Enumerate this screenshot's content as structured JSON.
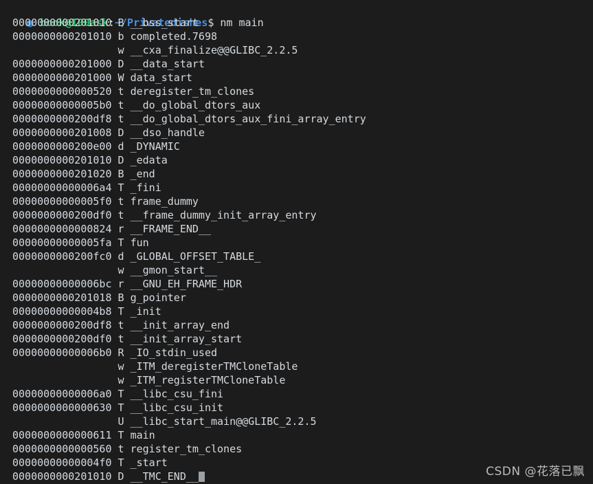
{
  "terminal": {
    "background_color": "#1c1c1c",
    "foreground_color": "#d6dbe0",
    "prompt": {
      "bullet": "●",
      "bullet_color": "#2878c0",
      "user_host": "book@100ask",
      "user_host_color": "#27c46b",
      "separator": ":",
      "path": "~/Privatedishes",
      "path_color": "#4a8fe0",
      "sigil_and_command": "$ nm main",
      "command": "nm main"
    },
    "output_lines": [
      "0000000000201010 B __bss_start",
      "0000000000201010 b completed.7698",
      "                 w __cxa_finalize@@GLIBC_2.2.5",
      "0000000000201000 D __data_start",
      "0000000000201000 W data_start",
      "0000000000000520 t deregister_tm_clones",
      "00000000000005b0 t __do_global_dtors_aux",
      "0000000000200df8 t __do_global_dtors_aux_fini_array_entry",
      "0000000000201008 D __dso_handle",
      "0000000000200e00 d _DYNAMIC",
      "0000000000201010 D _edata",
      "0000000000201020 B _end",
      "00000000000006a4 T _fini",
      "00000000000005f0 t frame_dummy",
      "0000000000200df0 t __frame_dummy_init_array_entry",
      "0000000000000824 r __FRAME_END__",
      "00000000000005fa T fun",
      "0000000000200fc0 d _GLOBAL_OFFSET_TABLE_",
      "                 w __gmon_start__",
      "00000000000006bc r __GNU_EH_FRAME_HDR",
      "0000000000201018 B g_pointer",
      "00000000000004b8 T _init",
      "0000000000200df8 t __init_array_end",
      "0000000000200df0 t __init_array_start",
      "00000000000006b0 R _IO_stdin_used",
      "                 w _ITM_deregisterTMCloneTable",
      "                 w _ITM_registerTMCloneTable",
      "00000000000006a0 T __libc_csu_fini",
      "0000000000000630 T __libc_csu_init",
      "                 U __libc_start_main@@GLIBC_2.2.5",
      "0000000000000611 T main",
      "0000000000000560 t register_tm_clones",
      "00000000000004f0 T _start",
      "0000000000201010 D __TMC_END__"
    ]
  },
  "watermark": {
    "text": "CSDN @花落已飘"
  }
}
